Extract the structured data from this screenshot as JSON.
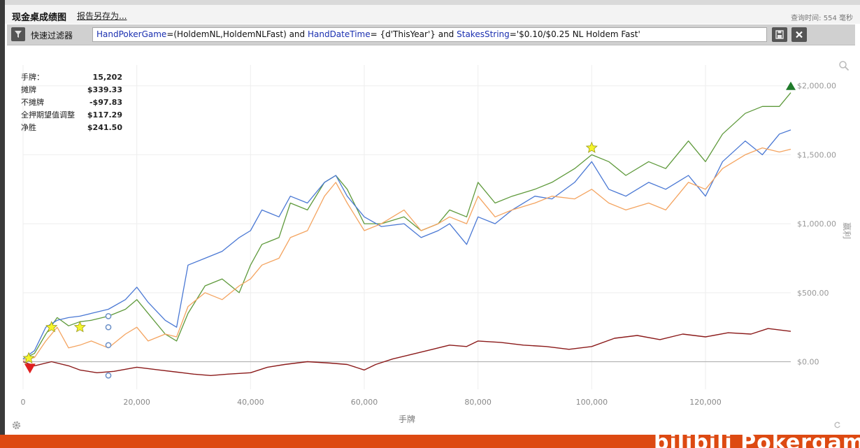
{
  "header": {
    "title": "现金桌成绩图",
    "save_as": "报告另存为...",
    "query_time": "查询时间: 554 毫秒"
  },
  "filter": {
    "label": "快速过滤器",
    "parts": [
      {
        "text": "HandPokerGame",
        "kw": true
      },
      {
        "text": "=(HoldemNL,HoldemNLFast) and ",
        "kw": false
      },
      {
        "text": "HandDateTime",
        "kw": true
      },
      {
        "text": "= {d'ThisYear'} and ",
        "kw": false
      },
      {
        "text": "StakesString",
        "kw": true
      },
      {
        "text": "='$0.10/$0.25 NL Holdem Fast'",
        "kw": false
      }
    ]
  },
  "stats": [
    {
      "label": "手牌：",
      "value": "15,202"
    },
    {
      "label": "摊牌",
      "value": "$339.33"
    },
    {
      "label": "不摊牌",
      "value": "-$97.83"
    },
    {
      "label": "全押期望值调整",
      "value": "$117.29"
    },
    {
      "label": "净胜",
      "value": "$241.50"
    }
  ],
  "chart_data": {
    "type": "line",
    "xlabel": "手牌",
    "ylabel": "赢利",
    "xlim": [
      0,
      135000
    ],
    "ylim": [
      -200,
      2100
    ],
    "x_ticks": [
      0,
      20000,
      40000,
      60000,
      80000,
      100000,
      120000
    ],
    "x_tick_labels": [
      "0",
      "20,000",
      "40,000",
      "60,000",
      "80,000",
      "100,000",
      "120,000"
    ],
    "y_ticks": [
      0,
      500,
      1000,
      1500,
      2000
    ],
    "y_tick_labels": [
      "$0.00",
      "$500.00",
      "$1,000.00",
      "$1,500.00",
      "$2,000.00"
    ],
    "colors": {
      "green": "#5f9a3c",
      "blue": "#4a78d4",
      "orange": "#f4a460",
      "red": "#8b1a1a"
    },
    "series": [
      {
        "color_key": "green",
        "x": [
          0,
          2000,
          4000,
          6000,
          8000,
          10000,
          12000,
          15000,
          18000,
          20000,
          22000,
          25000,
          27000,
          29000,
          32000,
          35000,
          38000,
          40000,
          42000,
          45000,
          47000,
          50000,
          53000,
          55000,
          57000,
          60000,
          63000,
          67000,
          70000,
          73000,
          75000,
          78000,
          80000,
          83000,
          86000,
          90000,
          93000,
          97000,
          100000,
          103000,
          106000,
          110000,
          113000,
          117000,
          120000,
          123000,
          127000,
          130000,
          133000,
          135000
        ],
        "y": [
          20,
          60,
          200,
          320,
          260,
          290,
          300,
          330,
          380,
          450,
          350,
          200,
          150,
          350,
          550,
          600,
          500,
          700,
          850,
          900,
          1150,
          1100,
          1300,
          1350,
          1250,
          1000,
          1000,
          1050,
          950,
          1000,
          1100,
          1050,
          1300,
          1150,
          1200,
          1250,
          1300,
          1400,
          1500,
          1450,
          1350,
          1450,
          1400,
          1600,
          1450,
          1650,
          1800,
          1850,
          1850,
          1950
        ]
      },
      {
        "color_key": "blue",
        "x": [
          0,
          2000,
          4000,
          6000,
          8000,
          10000,
          12000,
          15000,
          18000,
          20000,
          22000,
          25000,
          27000,
          29000,
          32000,
          35000,
          38000,
          40000,
          42000,
          45000,
          47000,
          50000,
          53000,
          55000,
          57000,
          60000,
          63000,
          67000,
          70000,
          73000,
          75000,
          78000,
          80000,
          83000,
          86000,
          90000,
          93000,
          97000,
          100000,
          103000,
          106000,
          110000,
          113000,
          117000,
          120000,
          123000,
          127000,
          130000,
          133000,
          135000
        ],
        "y": [
          20,
          80,
          250,
          300,
          320,
          330,
          350,
          380,
          450,
          540,
          430,
          300,
          250,
          700,
          750,
          800,
          900,
          950,
          1100,
          1050,
          1200,
          1150,
          1300,
          1350,
          1200,
          1050,
          980,
          1000,
          900,
          950,
          1000,
          850,
          1050,
          1000,
          1100,
          1200,
          1180,
          1300,
          1450,
          1250,
          1200,
          1300,
          1250,
          1350,
          1200,
          1450,
          1600,
          1500,
          1650,
          1680
        ]
      },
      {
        "color_key": "orange",
        "x": [
          0,
          2000,
          4000,
          6000,
          8000,
          10000,
          12000,
          15000,
          18000,
          20000,
          22000,
          25000,
          27000,
          29000,
          32000,
          35000,
          38000,
          40000,
          42000,
          45000,
          47000,
          50000,
          53000,
          55000,
          57000,
          60000,
          63000,
          67000,
          70000,
          73000,
          75000,
          78000,
          80000,
          83000,
          86000,
          90000,
          93000,
          97000,
          100000,
          103000,
          106000,
          110000,
          113000,
          117000,
          120000,
          123000,
          127000,
          130000,
          133000,
          135000
        ],
        "y": [
          10,
          30,
          150,
          250,
          100,
          120,
          150,
          100,
          200,
          250,
          150,
          200,
          180,
          400,
          500,
          450,
          550,
          600,
          700,
          750,
          900,
          950,
          1200,
          1300,
          1150,
          950,
          1000,
          1100,
          950,
          1000,
          1050,
          1000,
          1200,
          1050,
          1100,
          1150,
          1200,
          1180,
          1250,
          1150,
          1100,
          1150,
          1100,
          1300,
          1250,
          1400,
          1500,
          1550,
          1520,
          1540
        ]
      },
      {
        "color_key": "red",
        "x": [
          0,
          2000,
          5000,
          8000,
          10000,
          13000,
          16000,
          20000,
          24000,
          28000,
          30000,
          33000,
          36000,
          40000,
          43000,
          46000,
          50000,
          54000,
          57000,
          60000,
          62000,
          65000,
          68000,
          72000,
          75000,
          78000,
          80000,
          84000,
          88000,
          92000,
          96000,
          100000,
          104000,
          108000,
          112000,
          116000,
          120000,
          124000,
          128000,
          131000,
          135000
        ],
        "y": [
          0,
          -30,
          0,
          -30,
          -60,
          -80,
          -70,
          -40,
          -60,
          -80,
          -90,
          -100,
          -90,
          -80,
          -40,
          -20,
          0,
          -10,
          -20,
          -60,
          -20,
          20,
          50,
          90,
          120,
          110,
          150,
          140,
          120,
          110,
          90,
          110,
          170,
          190,
          160,
          200,
          180,
          210,
          200,
          240,
          220
        ]
      }
    ],
    "markers": {
      "stars": [
        {
          "x": 1000,
          "y": 25
        },
        {
          "x": 5000,
          "y": 250
        },
        {
          "x": 10000,
          "y": 250
        },
        {
          "x": 100000,
          "y": 1550
        }
      ],
      "circles": [
        {
          "x": 15000,
          "y": 330
        },
        {
          "x": 15000,
          "y": 250
        },
        {
          "x": 15000,
          "y": 120
        },
        {
          "x": 15000,
          "y": -100
        }
      ],
      "down_triangle": {
        "x": 1200,
        "y": -50
      },
      "up_triangle": {
        "x": 135000,
        "y": 2000
      }
    }
  }
}
